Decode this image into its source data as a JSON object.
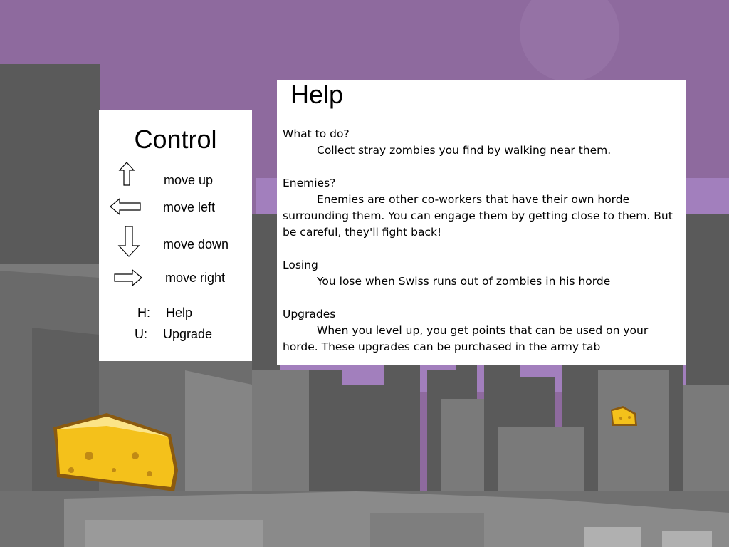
{
  "control": {
    "title": "Control",
    "rows": [
      {
        "icon": "arrow-up-icon",
        "label": "move up"
      },
      {
        "icon": "arrow-left-icon",
        "label": "move left"
      },
      {
        "icon": "arrow-down-icon",
        "label": "move down"
      },
      {
        "icon": "arrow-right-icon",
        "label": "move right"
      }
    ],
    "keys": [
      {
        "key": "H:",
        "action": "Help"
      },
      {
        "key": "U:",
        "action": "Upgrade"
      }
    ]
  },
  "help": {
    "title": "Help",
    "sections": [
      {
        "heading": "What to do?",
        "text": "Collect stray zombies you find by walking near them."
      },
      {
        "heading": "Enemies?",
        "text": "Enemies are other co-workers that have their own horde surrounding them. You can engage them by getting close to them. But be careful, they'll fight back!"
      },
      {
        "heading": "Losing",
        "text": "You lose when Swiss runs out of zombies in his horde"
      },
      {
        "heading": "Upgrades",
        "text": "When you level up, you get points that can be used on your horde. These upgrades can be purchased in the army tab"
      }
    ]
  },
  "colors": {
    "sky": "#8e6a9e",
    "sky_light": "#a27fbd",
    "building_dark": "#5a5a5a",
    "building_mid": "#7a7a7a",
    "building_light": "#9a9a9a",
    "cheese": "#f4c11b",
    "cheese_edge": "#8a5a10"
  }
}
